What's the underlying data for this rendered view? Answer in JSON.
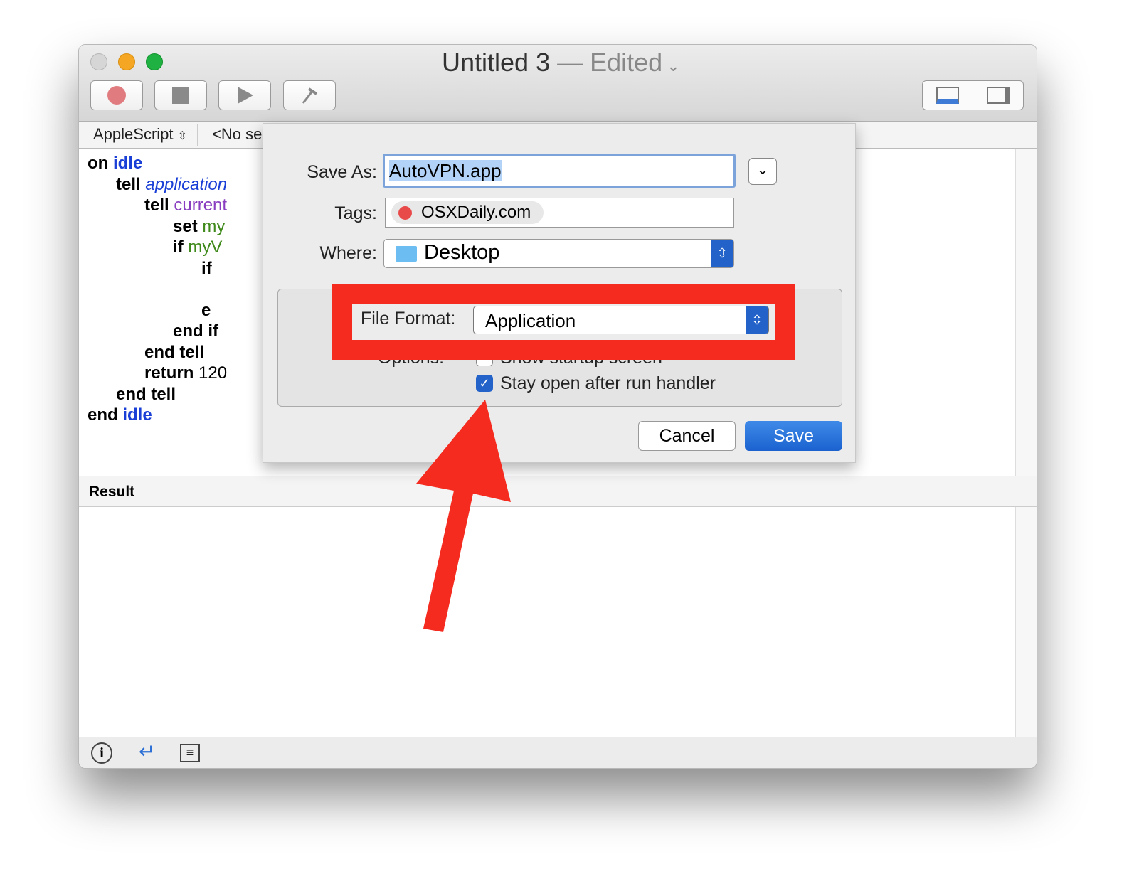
{
  "window": {
    "title": "Untitled 3",
    "edited": "— Edited",
    "traffic_colors": [
      "#d0d0d0",
      "#f5a623",
      "#1fb141"
    ]
  },
  "toolbar": {
    "buttons": [
      "record",
      "stop",
      "run",
      "compile"
    ],
    "view_buttons": [
      "show-bottom-pane",
      "show-side-pane"
    ]
  },
  "navbar": {
    "language": "AppleScript",
    "element": "<No se"
  },
  "code": [
    [
      {
        "t": "on ",
        "c": ""
      },
      {
        "t": "idle",
        "c": "kw"
      }
    ],
    [
      {
        "t": "      tell ",
        "c": ""
      },
      {
        "t": "application",
        "c": "it"
      }
    ],
    [
      {
        "t": "            tell ",
        "c": ""
      },
      {
        "t": "current",
        "c": "pu"
      }
    ],
    [
      {
        "t": "                  set ",
        "c": ""
      },
      {
        "t": "my",
        "c": "gr"
      }
    ],
    [
      {
        "t": "                  if ",
        "c": ""
      },
      {
        "t": "myV",
        "c": "gr"
      }
    ],
    [
      {
        "t": "                        if",
        "c": ""
      }
    ],
    [],
    [
      {
        "t": "                        e",
        "c": ""
      }
    ],
    [
      {
        "t": "                  end if",
        "c": ""
      }
    ],
    [
      {
        "t": "            end tell",
        "c": ""
      }
    ],
    [
      {
        "t": "            return ",
        "c": ""
      },
      {
        "t": "120",
        "c": "nm"
      }
    ],
    [
      {
        "t": "      end tell",
        "c": ""
      }
    ],
    [
      {
        "t": "end ",
        "c": ""
      },
      {
        "t": "idle",
        "c": "kw"
      }
    ]
  ],
  "result": {
    "label": "Result"
  },
  "dialog": {
    "save_as_label": "Save As:",
    "save_as_value": "AutoVPN.app",
    "tags_label": "Tags:",
    "tag": "OSXDaily.com",
    "tag_color": "#e84a4a",
    "where_label": "Where:",
    "where_value": "Desktop",
    "format_label": "File Format:",
    "format_value": "Application",
    "options_label": "Options:",
    "opt1": "Show startup screen",
    "opt1_checked": false,
    "opt2": "Stay open after run handler",
    "opt2_checked": true,
    "cancel": "Cancel",
    "save": "Save"
  },
  "annotation": {
    "color": "#f52b1f"
  }
}
